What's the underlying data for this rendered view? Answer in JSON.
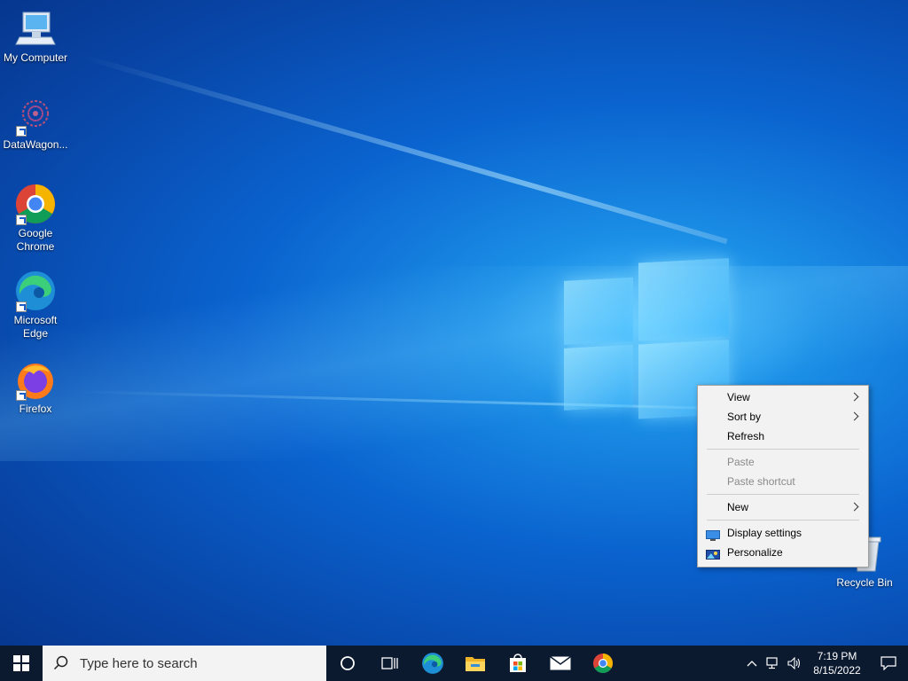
{
  "desktop": {
    "icons": [
      {
        "label": "My Computer"
      },
      {
        "label": "DataWagon..."
      },
      {
        "label": "Google Chrome"
      },
      {
        "label": "Microsoft Edge"
      },
      {
        "label": "Firefox"
      },
      {
        "label": "Recycle Bin"
      }
    ]
  },
  "context_menu": {
    "items": [
      {
        "label": "View",
        "submenu": true,
        "enabled": true
      },
      {
        "label": "Sort by",
        "submenu": true,
        "enabled": true
      },
      {
        "label": "Refresh",
        "submenu": false,
        "enabled": true
      },
      {
        "label": "Paste",
        "submenu": false,
        "enabled": false
      },
      {
        "label": "Paste shortcut",
        "submenu": false,
        "enabled": false
      },
      {
        "label": "New",
        "submenu": true,
        "enabled": true
      },
      {
        "label": "Display settings",
        "icon": "display-icon",
        "enabled": true
      },
      {
        "label": "Personalize",
        "icon": "personalize-icon",
        "enabled": true
      }
    ]
  },
  "taskbar": {
    "search_placeholder": "Type here to search",
    "pinned": [
      "cortana-icon",
      "task-view-icon",
      "edge-icon",
      "file-explorer-icon",
      "store-icon",
      "mail-icon",
      "chrome-icon"
    ],
    "clock": {
      "time": "7:19 PM",
      "date": "8/15/2022"
    }
  },
  "colors": {
    "taskbar_bg": "#0c1a30",
    "accent": "#0a63cf"
  }
}
